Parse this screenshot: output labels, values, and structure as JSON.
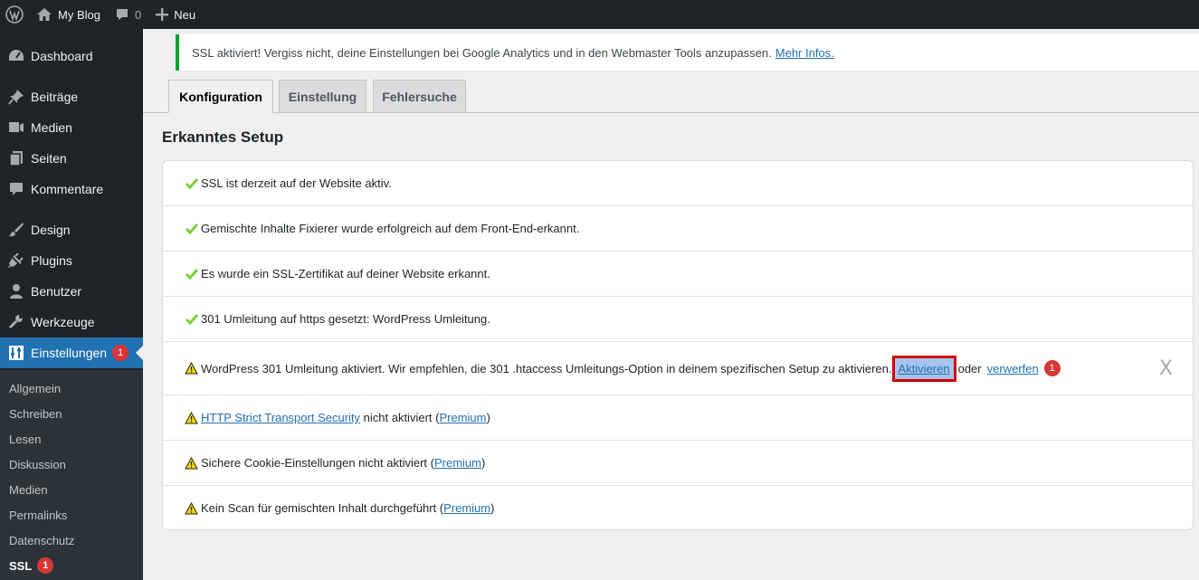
{
  "adminbar": {
    "site_name": "My Blog",
    "comment_count": "0",
    "new_label": "Neu"
  },
  "sidebar": {
    "items": [
      {
        "label": "Dashboard",
        "icon": "dashboard-icon"
      },
      {
        "label": "Beiträge",
        "icon": "pin-icon"
      },
      {
        "label": "Medien",
        "icon": "media-icon"
      },
      {
        "label": "Seiten",
        "icon": "pages-icon"
      },
      {
        "label": "Kommentare",
        "icon": "comment-icon"
      },
      {
        "label": "Design",
        "icon": "brush-icon"
      },
      {
        "label": "Plugins",
        "icon": "plugin-icon"
      },
      {
        "label": "Benutzer",
        "icon": "user-icon"
      },
      {
        "label": "Werkzeuge",
        "icon": "wrench-icon"
      },
      {
        "label": "Einstellungen",
        "icon": "settings-icon",
        "badge": "1"
      }
    ],
    "submenu": [
      {
        "label": "Allgemein"
      },
      {
        "label": "Schreiben"
      },
      {
        "label": "Lesen"
      },
      {
        "label": "Diskussion"
      },
      {
        "label": "Medien"
      },
      {
        "label": "Permalinks"
      },
      {
        "label": "Datenschutz"
      },
      {
        "label": "SSL",
        "badge": "1"
      }
    ]
  },
  "notice": {
    "text": "SSL aktiviert! Vergiss nicht, deine Einstellungen bei Google Analytics und in den Webmaster Tools anzupassen.",
    "link": "Mehr Infos."
  },
  "tabs": [
    {
      "label": "Konfiguration",
      "active": true
    },
    {
      "label": "Einstellung"
    },
    {
      "label": "Fehlersuche"
    }
  ],
  "section_title": "Erkanntes Setup",
  "rows": {
    "r1": "SSL ist derzeit auf der Website aktiv.",
    "r2": "Gemischte Inhalte Fixierer wurde erfolgreich auf dem Front-End-erkannt.",
    "r3": "Es wurde ein SSL-Zertifikat auf deiner Website erkannt.",
    "r4": "301 Umleitung auf https gesetzt: WordPress Umleitung.",
    "r5": {
      "text": "WordPress 301 Umleitung aktiviert. Wir empfehlen, die 301 .htaccess Umleitungs-Option in deinem spezifischen Setup zu aktivieren.",
      "activate": "Aktivieren",
      "or": "oder",
      "dismiss_link": "verwerfen",
      "badge": "1",
      "close": "X"
    },
    "r6": {
      "link": "HTTP Strict Transport Security",
      "text": " nicht aktiviert (",
      "premium": "Premium",
      "close_paren": ")"
    },
    "r7": {
      "text": "Sichere Cookie-Einstellungen nicht aktiviert (",
      "premium": "Premium",
      "close_paren": ")"
    },
    "r8": {
      "text": "Kein Scan für gemischten Inhalt durchgeführt (",
      "premium": "Premium",
      "close_paren": ")"
    }
  },
  "colors": {
    "success": "#7ad03a",
    "warning": "#f8d900",
    "accent": "#2271b1",
    "badge": "#d63638"
  }
}
